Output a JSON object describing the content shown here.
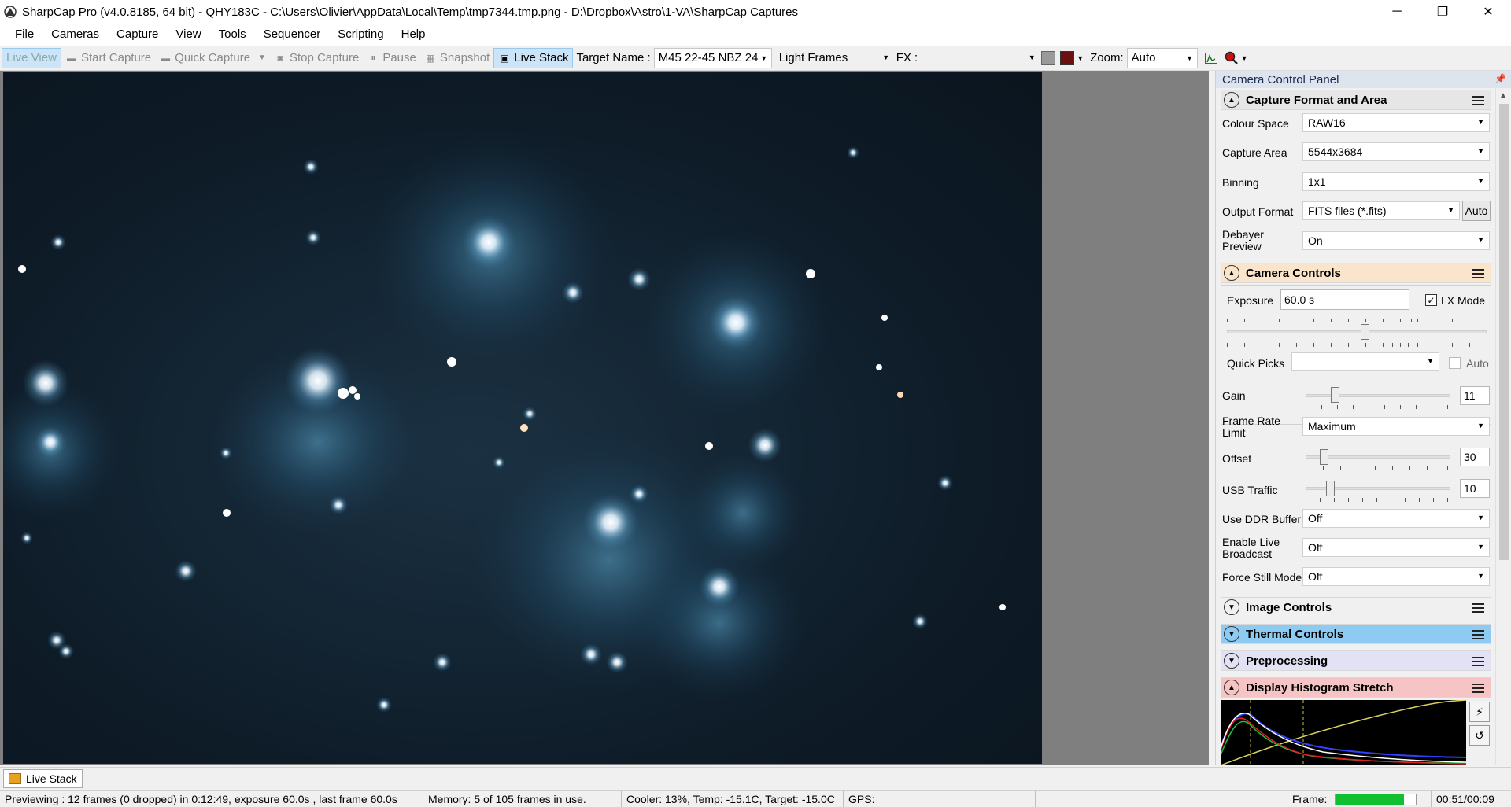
{
  "window": {
    "title": "SharpCap Pro (v4.0.8185, 64 bit) - QHY183C - C:\\Users\\Olivier\\AppData\\Local\\Temp\\tmp7344.tmp.png - D:\\Dropbox\\Astro\\1-VA\\SharpCap Captures",
    "minimize": "─",
    "restore": "❐",
    "close": "✕"
  },
  "menu": [
    "File",
    "Cameras",
    "Capture",
    "View",
    "Tools",
    "Sequencer",
    "Scripting",
    "Help"
  ],
  "toolbar": {
    "live_view": "Live View",
    "start_capture": "Start Capture",
    "quick_capture": "Quick Capture",
    "stop_capture": "Stop Capture",
    "pause": "Pause",
    "snapshot": "Snapshot",
    "live_stack": "Live Stack",
    "target_name_label": "Target Name :",
    "target_name_value": "M45 22-45 NBZ 24",
    "frame_type": "Light Frames",
    "fx_label": "FX :",
    "fx_value": "",
    "zoom_label": "Zoom:",
    "zoom_value": "Auto"
  },
  "panel": {
    "title": "Camera Control Panel",
    "capture_format": {
      "header": "Capture Format and Area",
      "colour_space_label": "Colour Space",
      "colour_space": "RAW16",
      "capture_area_label": "Capture Area",
      "capture_area": "5544x3684",
      "binning_label": "Binning",
      "binning": "1x1",
      "output_format_label": "Output Format",
      "output_format": "FITS files (*.fits)",
      "auto_button": "Auto",
      "debayer_label_1": "Debayer",
      "debayer_label_2": "Preview",
      "debayer": "On"
    },
    "camera_controls": {
      "header": "Camera Controls",
      "exposure_label": "Exposure",
      "exposure": "60.0 s",
      "lx_mode_label": "LX Mode",
      "lx_mode_checked": true,
      "quick_picks_label": "Quick Picks",
      "quick_picks": "",
      "auto_label": "Auto",
      "gain_label": "Gain",
      "gain": "11",
      "frame_rate_label_1": "Frame Rate",
      "frame_rate_label_2": "Limit",
      "frame_rate": "Maximum",
      "offset_label": "Offset",
      "offset": "30",
      "usb_traffic_label": "USB Traffic",
      "usb_traffic": "10",
      "ddr_label": "Use DDR Buffer",
      "ddr": "Off",
      "broadcast_label_1": "Enable Live",
      "broadcast_label_2": "Broadcast",
      "broadcast": "Off",
      "still_label": "Force Still Mode",
      "still": "Off"
    },
    "image_controls": "Image Controls",
    "thermal_controls": "Thermal Controls",
    "preprocessing": "Preprocessing",
    "histogram": "Display Histogram Stretch"
  },
  "bottom_tab": "Live Stack",
  "status": {
    "previewing": "Previewing : 12 frames (0 dropped) in 0:12:49, exposure 60.0s , last frame 60.0s",
    "memory": "Memory: 5 of 105 frames in use.",
    "cooler": "Cooler: 13%, Temp: -15.1C, Target: -15.0C",
    "gps": "GPS:",
    "frame_label": "Frame:",
    "frame_progress": 0.85,
    "frame_time": "00:51/00:09"
  },
  "colors": {
    "camera_controls_header": "#fbe4cc",
    "capture_format_header": "#e6e6e6",
    "image_controls_header": "#f0f0f0",
    "thermal_controls_header": "#8ecbf2",
    "preprocessing_header": "#e2e2f4",
    "histogram_header": "#f6c4c4",
    "sky": "#0d1a26"
  }
}
